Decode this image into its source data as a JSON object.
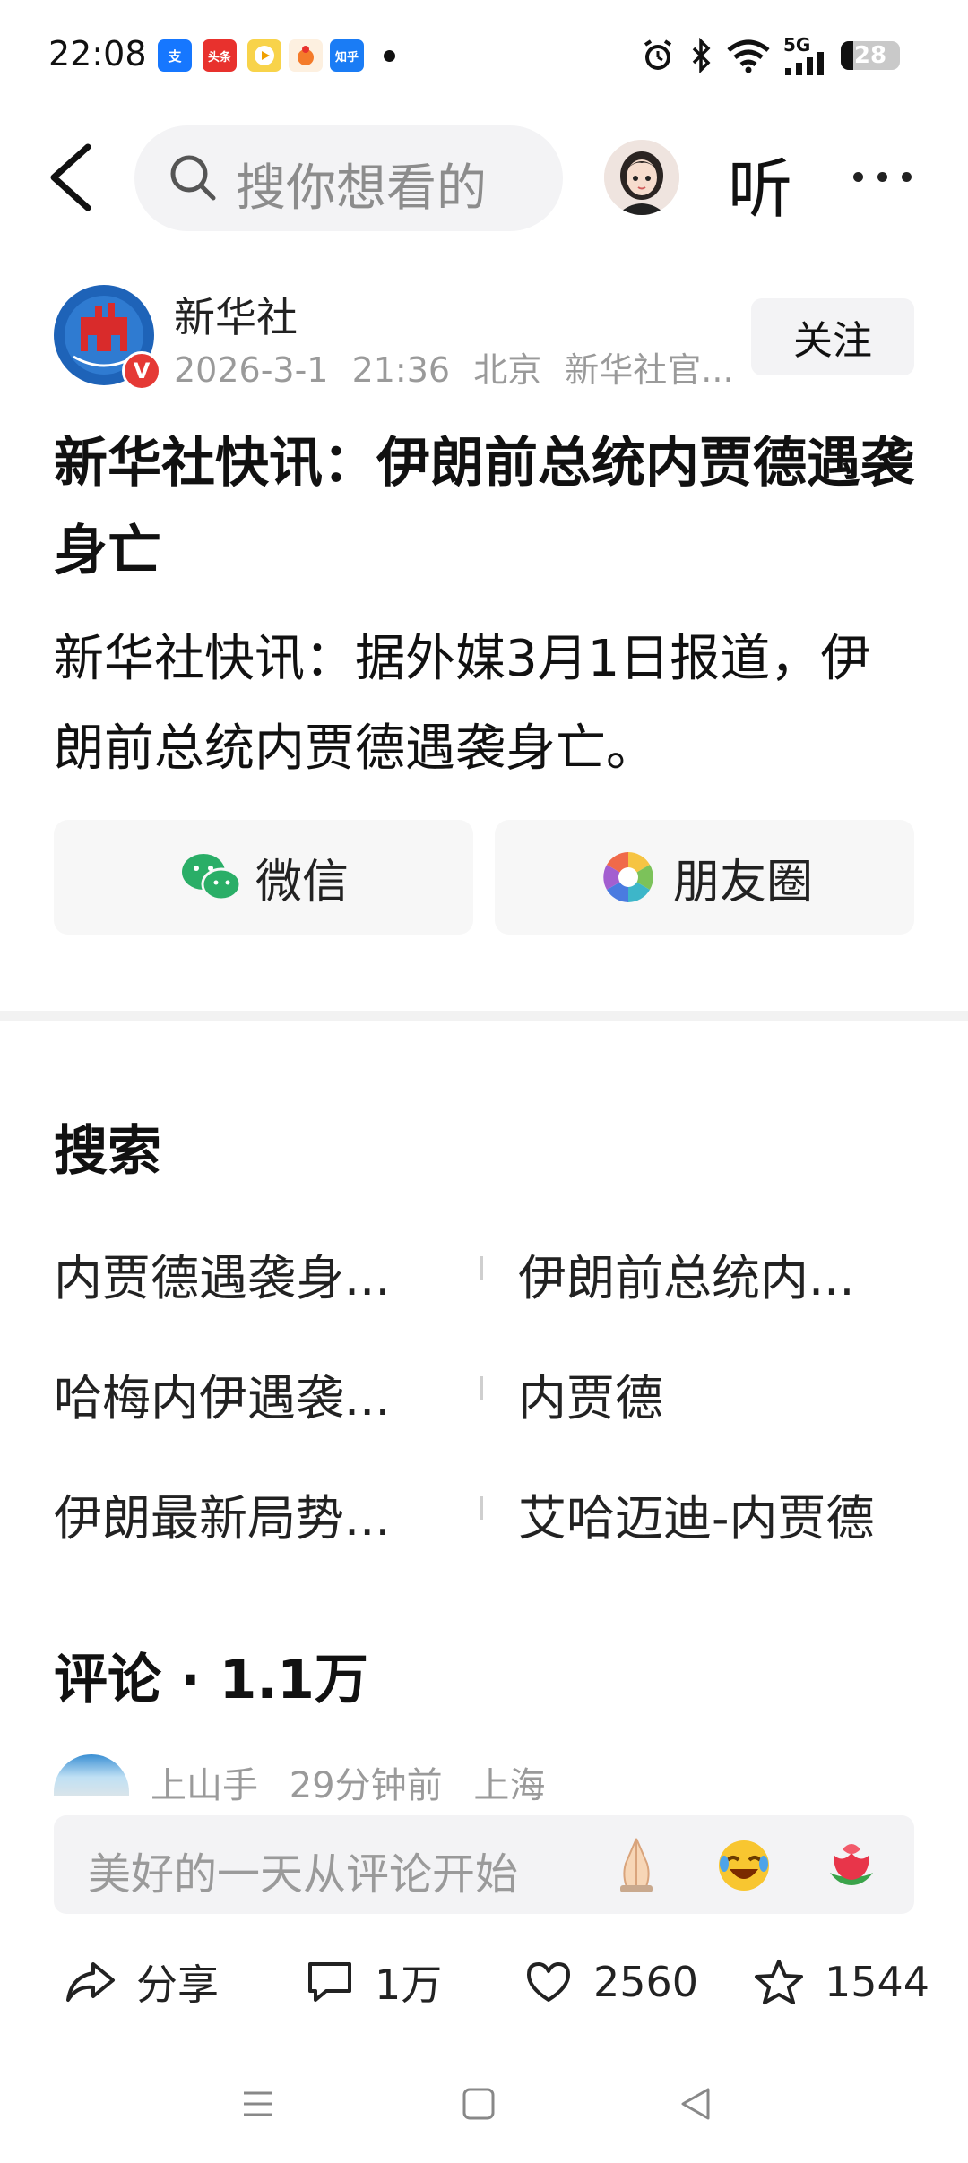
{
  "status_bar": {
    "time": "22:08",
    "app_icons": [
      {
        "name": "alipay-icon",
        "text": "支",
        "color": "#1677ff"
      },
      {
        "name": "toutiao-icon",
        "text": "头条",
        "color": "#e8312d"
      },
      {
        "name": "video-app-icon",
        "text": "",
        "color": "#f8d34a"
      },
      {
        "name": "baidu-icon",
        "text": "",
        "color": "#f4a63a"
      },
      {
        "name": "zhihu-icon",
        "text": "知乎",
        "color": "#1a7cf5"
      }
    ],
    "network": "5G",
    "battery": "28"
  },
  "top_nav": {
    "search_placeholder": "搜你想看的",
    "listen_label": "听"
  },
  "author": {
    "name": "新华社",
    "date": "2026-3-1",
    "time": "21:36",
    "location": "北京",
    "source": "新华社官...",
    "verified_badge": "V",
    "follow_label": "关注"
  },
  "article": {
    "title": "新华社快讯：伊朗前总统内贾德遇袭身亡",
    "body": "新华社快讯：据外媒3月1日报道，伊朗前总统内贾德遇袭身亡。"
  },
  "share": {
    "wechat_label": "微信",
    "moments_label": "朋友圈"
  },
  "search_section": {
    "title": "搜索",
    "suggestions": [
      "内贾德遇袭身...",
      "伊朗前总统内...",
      "哈梅内伊遇袭...",
      "内贾德",
      "伊朗最新局势...",
      "艾哈迈迪-内贾德"
    ]
  },
  "comments": {
    "title": "评论 · 1.1万",
    "first_comment": {
      "user": "上山手",
      "time": "29分钟前",
      "location": "上海"
    },
    "input_placeholder": "美好的一天从评论开始"
  },
  "action_bar": {
    "share_label": "分享",
    "comment_count": "1万",
    "like_count": "2560",
    "favorite_count": "1544"
  },
  "colors": {
    "accent_blue": "#1e63b8",
    "verified_red": "#e53935",
    "wechat_green": "#2aae67"
  }
}
